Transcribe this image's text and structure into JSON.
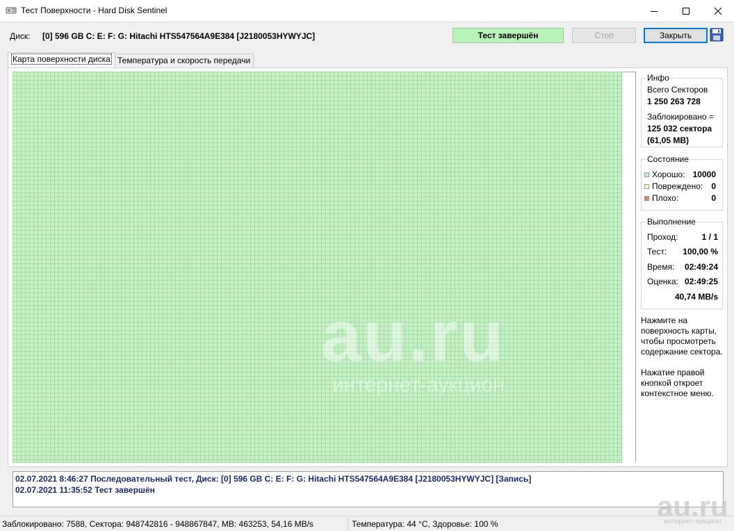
{
  "window": {
    "title": "Тест Поверхности - Hard Disk Sentinel"
  },
  "header": {
    "disk_label": "Диск:",
    "disk_value": "[0] 596 GB C: E: F: G: Hitachi HTS547564A9E384 [J2180053HYWYJC]",
    "status": "Тест завершён",
    "stop_label": "Стоп",
    "close_label": "Закрыть"
  },
  "tabs": [
    {
      "label": "Карта поверхности диска"
    },
    {
      "label": "Температура и скорость передачи"
    }
  ],
  "info": {
    "title": "Инфо",
    "total_sectors_label": "Всего Секторов",
    "total_sectors_value": "1 250 263 728",
    "blocked_label": "Заблокировано =",
    "blocked_value": "125 032 сектора",
    "blocked_size": "(61,05 MB)"
  },
  "state": {
    "title": "Состояние",
    "good_label": "Хорошо:",
    "good_value": "10000",
    "damaged_label": "Повреждено:",
    "damaged_value": "0",
    "bad_label": "Плохо:",
    "bad_value": "0"
  },
  "progress": {
    "title": "Выполнение",
    "pass_label": "Проход:",
    "pass_value": "1 / 1",
    "test_label": "Тест:",
    "test_value": "100,00 %",
    "time_label": "Время:",
    "time_value": "02:49:24",
    "estimate_label": "Оценка:",
    "estimate_value": "02:49:25",
    "speed": "40,74 MB/s"
  },
  "hints": {
    "hint1": "Нажмите на поверхность карты, чтобы просмотреть содержание сектора.",
    "hint2": "Нажатие правой кнопкой откроет контекстное меню."
  },
  "log": [
    "02.07.2021  8:46:27   Последовательный тест, Диск: [0] 596 GB C: E: F: G: Hitachi HTS547564A9E384 [J2180053HYWYJC] [Запись]",
    "02.07.2021  11:35:52   Тест завершён"
  ],
  "statusbar": {
    "left": "Заблокировано: 7588, Сектора: 948742816 - 948867847, MB: 463253, 54,16 MB/s",
    "right": "Температура: 44  °C,  Здоровье: 100 %"
  },
  "watermark": {
    "big": "au.ru",
    "small": "интернет-аукцион"
  },
  "colors": {
    "good": "#c6f1c6",
    "damaged": "#f7f7c0",
    "bad": "#d88080",
    "status_ok": "#b8f3b8"
  }
}
